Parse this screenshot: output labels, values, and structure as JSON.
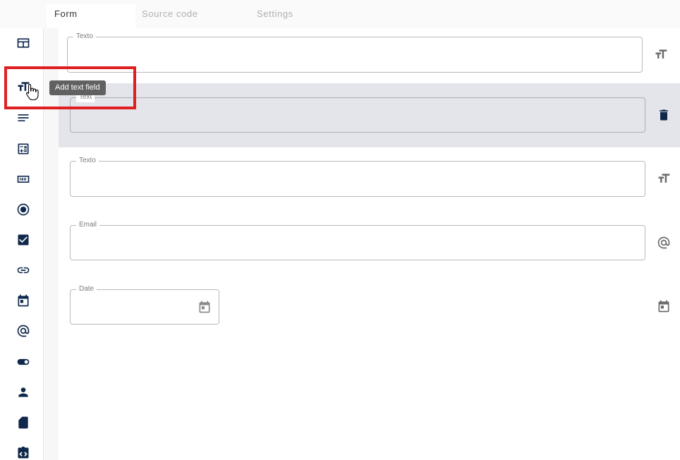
{
  "tabs": [
    {
      "label": "Form",
      "active": true
    },
    {
      "label": "Source code",
      "active": false
    },
    {
      "label": "Settings",
      "active": false
    }
  ],
  "sidebar": {
    "items": [
      {
        "icon": "layout-icon"
      },
      {
        "icon": "text-field-icon",
        "tooltip": "Add text field"
      },
      {
        "icon": "textarea-icon"
      },
      {
        "icon": "calculator-icon"
      },
      {
        "icon": "number-icon"
      },
      {
        "icon": "radio-icon"
      },
      {
        "icon": "checkbox-icon"
      },
      {
        "icon": "link-icon"
      },
      {
        "icon": "calendar-icon"
      },
      {
        "icon": "at-icon"
      },
      {
        "icon": "toggle-icon"
      },
      {
        "icon": "person-icon"
      },
      {
        "icon": "file-icon"
      },
      {
        "icon": "code-icon"
      }
    ]
  },
  "fields": [
    {
      "label": "Texto",
      "value": "",
      "action_icon": "text-field-icon"
    },
    {
      "label": "Text",
      "value": "",
      "action_icon": "delete-icon",
      "selected": true
    },
    {
      "label": "Texto",
      "value": "",
      "action_icon": "text-field-icon"
    },
    {
      "label": "Email",
      "value": "",
      "action_icon": "at-icon"
    },
    {
      "label": "Date",
      "value": "",
      "action_icon": "calendar-icon"
    }
  ],
  "tooltip": {
    "text": "Add text field"
  },
  "colors": {
    "accent": "#10284b",
    "highlight": "#e02020",
    "selected_row": "#e3e5ea"
  }
}
